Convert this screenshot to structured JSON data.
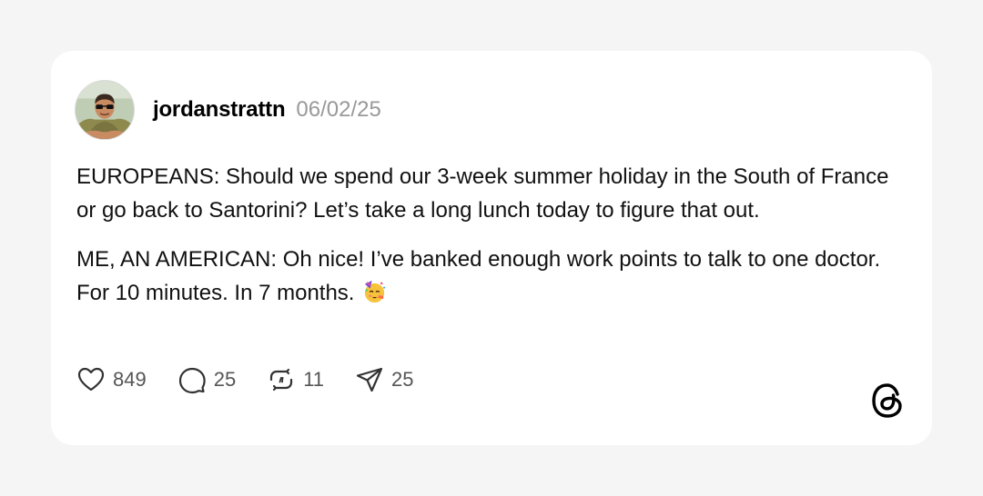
{
  "post": {
    "author": {
      "username": "jordanstrattn",
      "date": "06/02/25",
      "avatar_icon": "profile-photo"
    },
    "paragraphs": [
      "EUROPEANS: Should we spend our 3-week summer holiday in the South of France or go back to Santorini? Let’s take a long lunch today to figure that out.",
      "ME, AN AMERICAN: Oh nice! I’ve banked enough work points to talk to one doctor. For 10 minutes. In 7 months."
    ],
    "emoji": "partying-face",
    "actions": {
      "like": {
        "icon": "heart-icon",
        "count": "849"
      },
      "reply": {
        "icon": "comment-bubble-icon",
        "count": "25"
      },
      "repost": {
        "icon": "repost-icon",
        "count": "11"
      },
      "share": {
        "icon": "send-icon",
        "count": "25"
      }
    },
    "brand": {
      "logo": "threads-logo"
    }
  },
  "colors": {
    "page_background": "#f5f5f5",
    "card_background": "#ffffff",
    "muted_text": "#999999"
  }
}
